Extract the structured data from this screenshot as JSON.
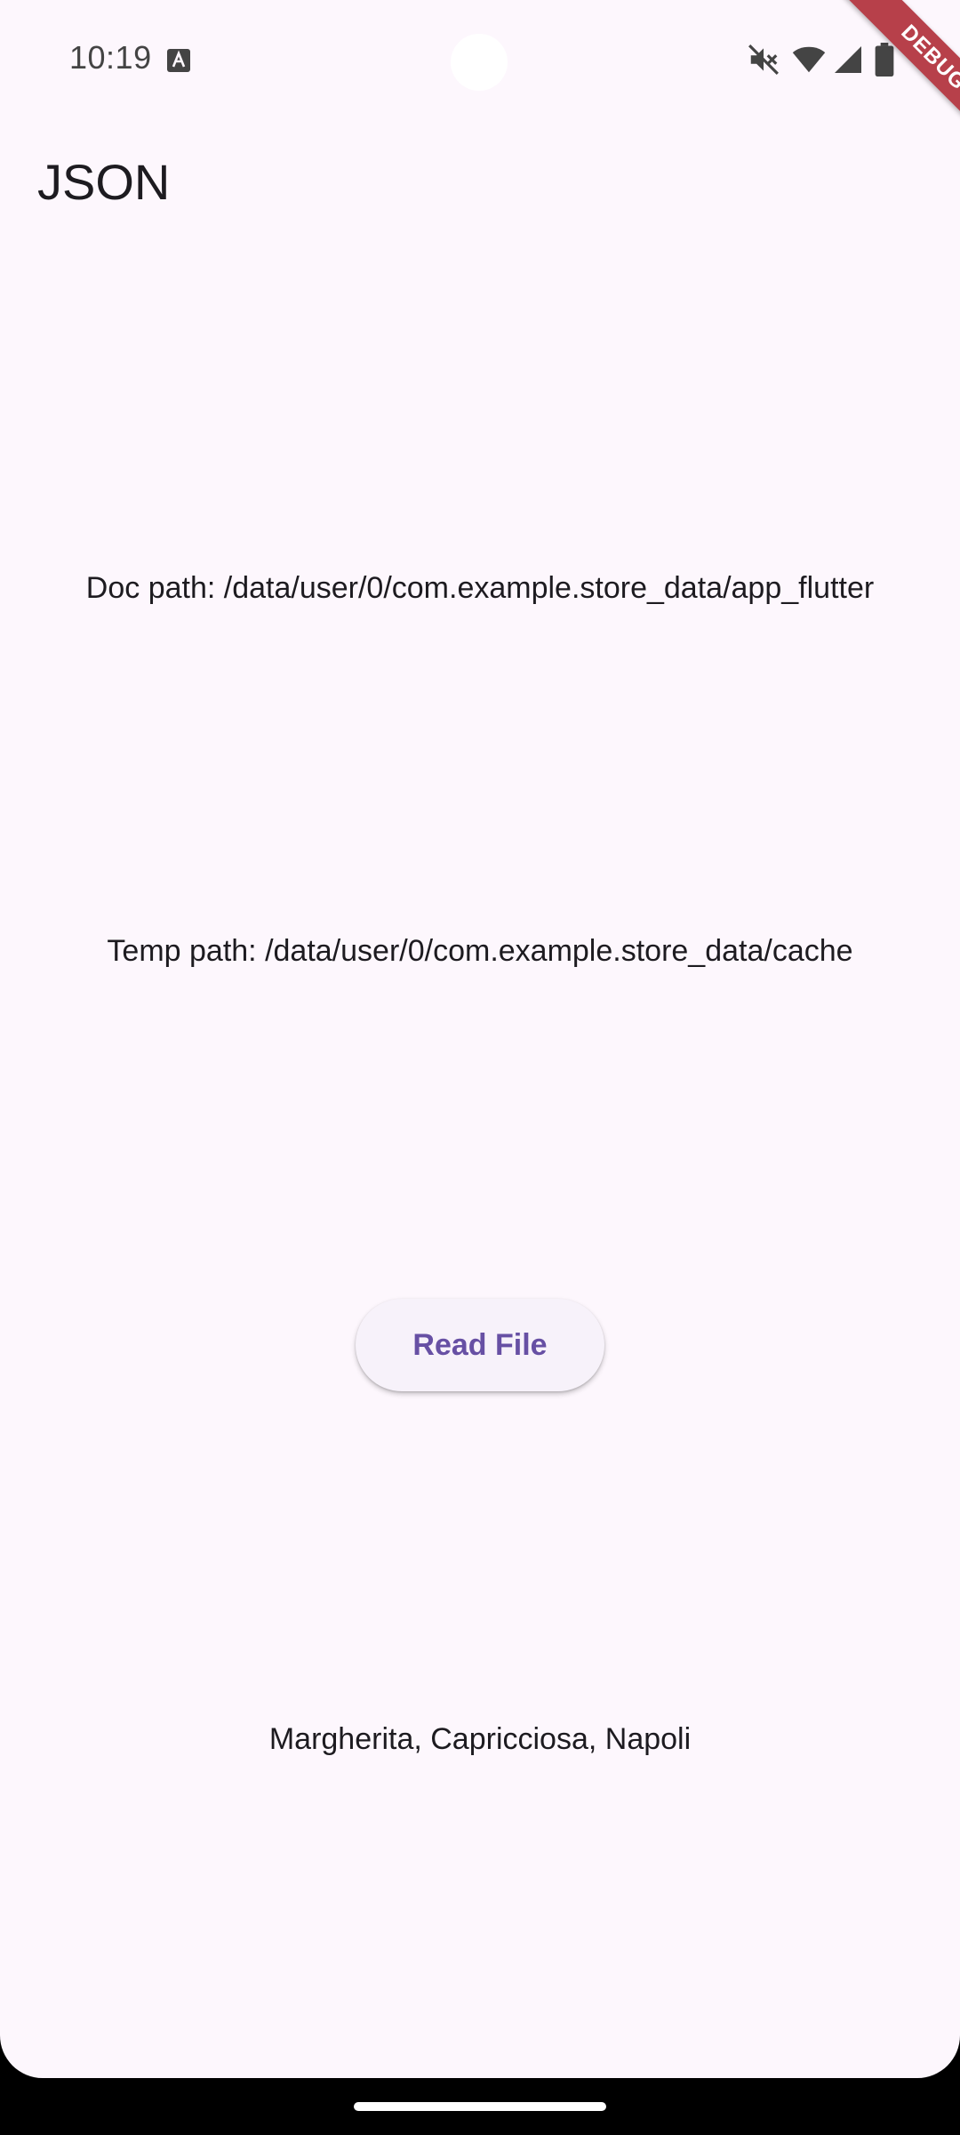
{
  "status_bar": {
    "time": "10:19",
    "icons": [
      "keyboard-a-icon",
      "mute-icon",
      "wifi-icon",
      "signal-icon",
      "battery-icon"
    ]
  },
  "debug_banner": "DEBUG",
  "app_bar": {
    "title": "JSON"
  },
  "main": {
    "doc_path": "Doc path: /data/user/0/com.example.store_data/app_flutter",
    "temp_path": "Temp path: /data/user/0/com.example.store_data/cache",
    "read_button_label": "Read File",
    "result": "Margherita, Capricciosa, Napoli"
  },
  "colors": {
    "background": "#FDF7FD",
    "primary": "#6750A4",
    "button_surface": "#F7F2FA",
    "text": "#1D1B20",
    "debug_banner": "#B7404A"
  }
}
